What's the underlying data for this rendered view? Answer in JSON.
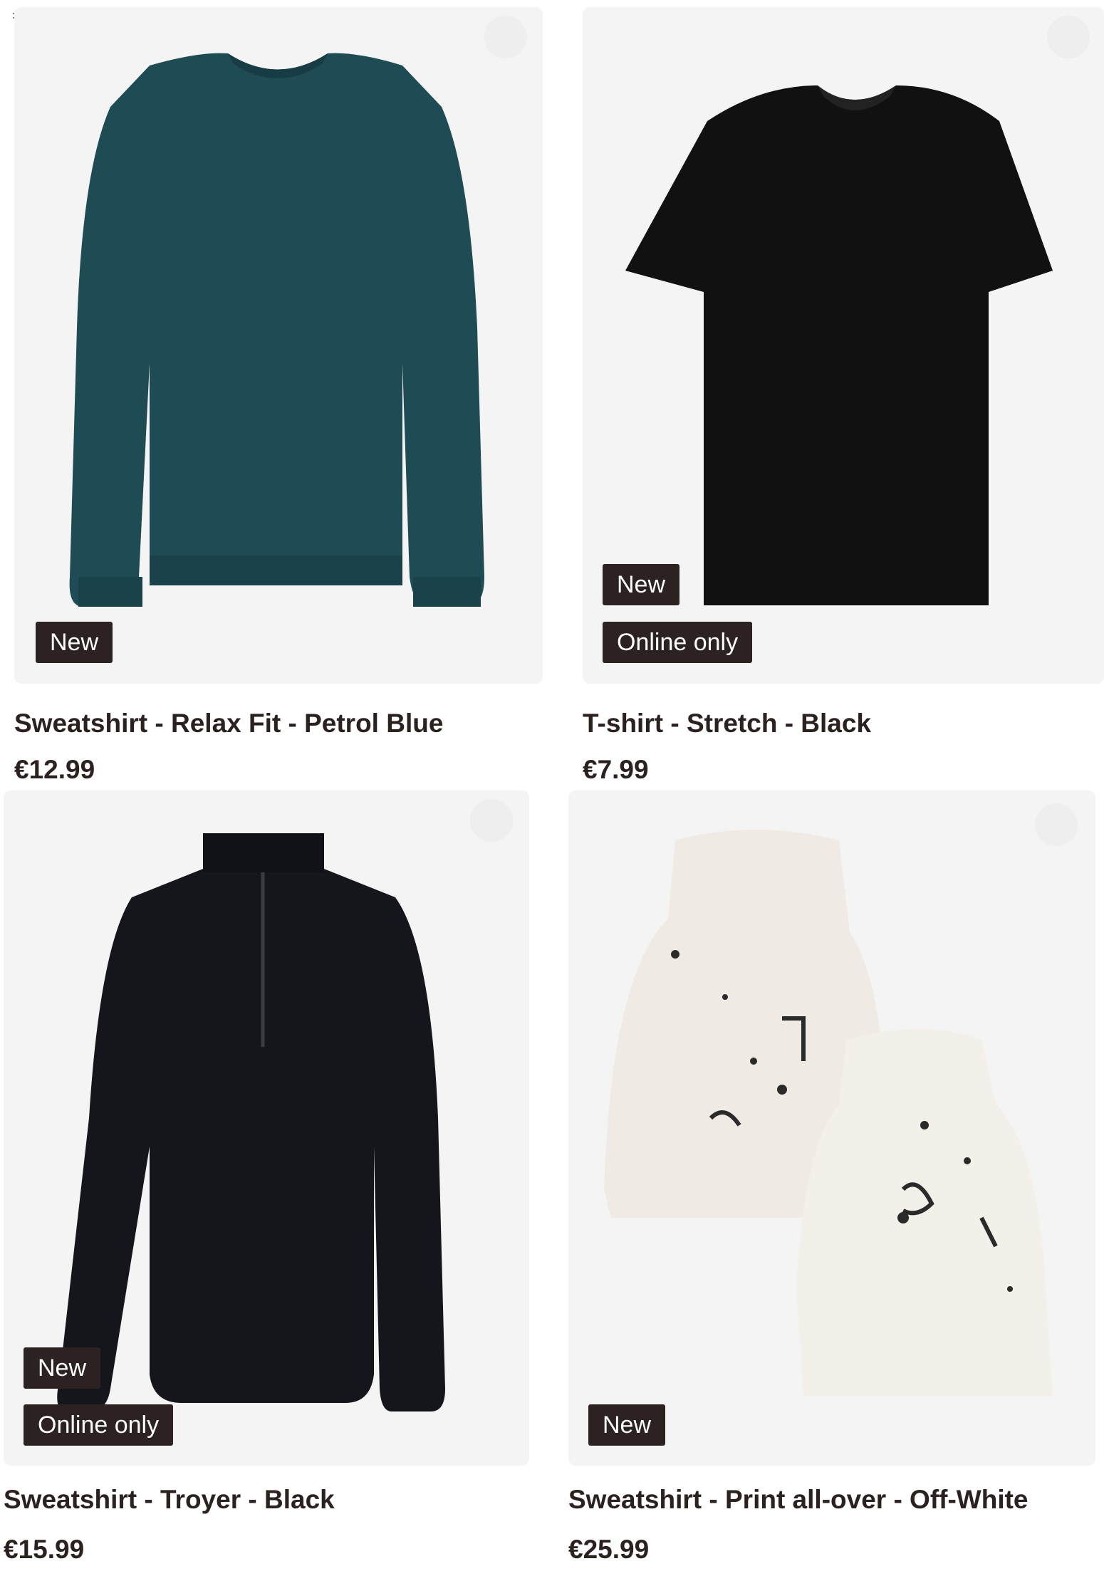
{
  "products": [
    {
      "title": "Sweatshirt - Relax Fit - Petrol Blue",
      "price": "€12.99",
      "badges": [
        "New"
      ],
      "color": "#1f4b55",
      "icon": "crew-neck-sweatshirt"
    },
    {
      "title": "T-shirt - Stretch - Black",
      "price": "€7.99",
      "badges": [
        "New",
        "Online only"
      ],
      "color": "#111111",
      "icon": "t-shirt"
    },
    {
      "title": "Sweatshirt - Troyer - Black",
      "price": "€15.99",
      "badges": [
        "New",
        "Online only"
      ],
      "color": "#14161c",
      "icon": "half-zip-sweatshirt"
    },
    {
      "title": "Sweatshirt - Print all-over - Off-White",
      "price": "€25.99",
      "badges": [
        "New"
      ],
      "color": "#efeae3",
      "icon": "printed-hoodies"
    }
  ],
  "colors": {
    "badge_bg": "#2b2221",
    "tile_bg": "#f4f4f4",
    "text": "#2b2220"
  }
}
